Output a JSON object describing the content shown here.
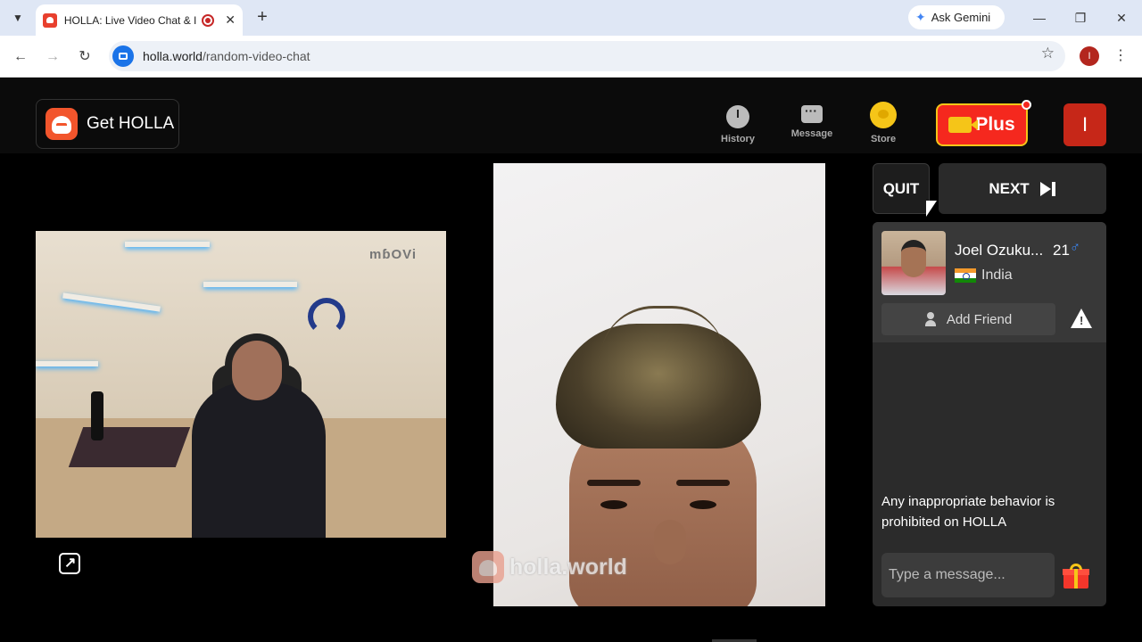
{
  "browser": {
    "tab_title": "HOLLA: Live Video Chat & I",
    "new_tab_symbol": "+",
    "gemini_label": "Ask Gemini",
    "url_domain": "holla.world",
    "url_path": "/random-video-chat",
    "profile_initial": "I"
  },
  "header": {
    "get_app_label": "Get HOLLA",
    "nav": [
      {
        "label": "History",
        "icon": "history-icon"
      },
      {
        "label": "Message",
        "icon": "message-icon"
      },
      {
        "label": "Store",
        "icon": "store-coin-icon"
      }
    ],
    "plus_label": "Plus",
    "user_initial": "I"
  },
  "video": {
    "local_watermark": "mɓOVi",
    "remote_watermark": "holla.world"
  },
  "controls": {
    "quit_label": "QUIT",
    "next_label": "NEXT"
  },
  "partner": {
    "name": "Joel Ozuku...",
    "age": "21",
    "gender_symbol": "♂",
    "country": "India",
    "add_friend_label": "Add Friend"
  },
  "chat": {
    "notice": "Any inappropriate behavior is prohibited on HOLLA",
    "input_placeholder": "Type a message..."
  },
  "colors": {
    "accent_red": "#f5281e",
    "gold": "#f5c518",
    "panel_bg": "#2b2b2b"
  }
}
